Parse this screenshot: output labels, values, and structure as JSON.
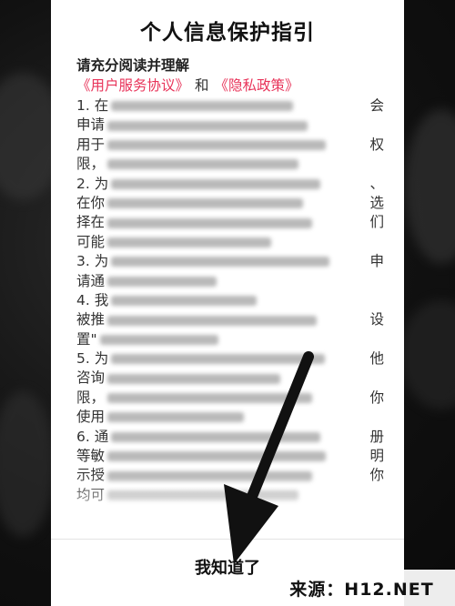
{
  "dialog": {
    "title": "个人信息保护指引",
    "intro": "请充分阅读并理解",
    "link_user_agreement": "《用户服务协议》",
    "and": "和",
    "link_privacy_policy": "《隐私政策》",
    "paragraphs": [
      {
        "start": "1. 在",
        "end": "会"
      },
      {
        "start": "申请",
        "end": ""
      },
      {
        "start": "用于",
        "end": "权"
      },
      {
        "start": "限，",
        "end": ""
      },
      {
        "start": "2. 为",
        "end": "、"
      },
      {
        "start": "在你",
        "end": "选"
      },
      {
        "start": "择在",
        "end": "们"
      },
      {
        "start": "可能",
        "end": ""
      },
      {
        "start": "3. 为",
        "end": "申"
      },
      {
        "start": "请通",
        "end": ""
      },
      {
        "start": "4. 我",
        "end": ""
      },
      {
        "start": "被推",
        "end": "设"
      },
      {
        "start": "置\"",
        "end": ""
      },
      {
        "start": "5. 为",
        "end": "他"
      },
      {
        "start": "咨询",
        "end": ""
      },
      {
        "start": "限，",
        "end": "你"
      },
      {
        "start": "使用",
        "end": ""
      },
      {
        "start": "6. 通",
        "end": "册"
      },
      {
        "start": "等敏",
        "end": "明"
      },
      {
        "start": "示授",
        "end": "你"
      },
      {
        "start": "均可",
        "end": ""
      }
    ],
    "ok_button": "我知道了"
  },
  "watermark": {
    "text": "来源：H12.NET"
  },
  "colors": {
    "link": "#e8345a",
    "arrow": "#111111"
  }
}
